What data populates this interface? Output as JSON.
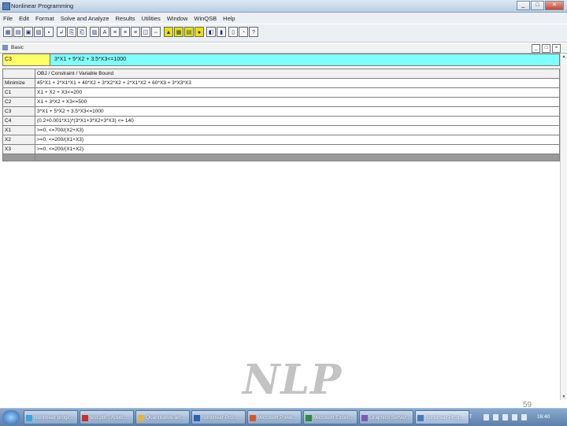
{
  "window": {
    "title": "Nonlinear Programming",
    "min": "_",
    "max": "□",
    "close": "✕"
  },
  "menu": [
    "File",
    "Edit",
    "Format",
    "Solve and Analyze",
    "Results",
    "Utilities",
    "Window",
    "WinQSB",
    "Help"
  ],
  "toolbar": {
    "buttons": [
      {
        "glyph": "▦",
        "icon": "new-icon",
        "hl": false
      },
      {
        "glyph": "▤",
        "icon": "open-icon",
        "hl": false
      },
      {
        "glyph": "▣",
        "icon": "save-icon",
        "hl": false
      },
      {
        "glyph": "▧",
        "icon": "print-icon",
        "hl": false
      },
      {
        "glyph": "▪",
        "icon": "print-setup-icon",
        "hl": false
      },
      {
        "glyph": "↲",
        "icon": "cut-icon",
        "hl": false
      },
      {
        "glyph": "⎘",
        "icon": "copy-icon",
        "hl": false
      },
      {
        "glyph": "⎗",
        "icon": "paste-icon",
        "hl": false
      },
      {
        "glyph": "▥",
        "icon": "format-number-icon",
        "hl": false
      },
      {
        "glyph": "A",
        "icon": "font-icon",
        "hl": false
      },
      {
        "glyph": "≡",
        "icon": "align-left-icon",
        "hl": false
      },
      {
        "glyph": "≡",
        "icon": "align-center-icon",
        "hl": false
      },
      {
        "glyph": "≡",
        "icon": "align-right-icon",
        "hl": false
      },
      {
        "glyph": "◫",
        "icon": "row-height-icon",
        "hl": false
      },
      {
        "glyph": "⇔",
        "icon": "column-width-icon",
        "hl": false
      },
      {
        "glyph": "▲",
        "icon": "solve-icon",
        "hl": true
      },
      {
        "glyph": "▦",
        "icon": "grid-solve-icon",
        "hl": true
      },
      {
        "glyph": "▤",
        "icon": "analysis-icon",
        "hl": true
      },
      {
        "glyph": "●",
        "icon": "graph-icon",
        "hl": true
      },
      {
        "glyph": "◧",
        "icon": "chart-icon",
        "hl": false
      },
      {
        "glyph": "▮",
        "icon": "bar-chart-icon",
        "hl": false
      },
      {
        "glyph": "▯",
        "icon": "window-icon",
        "hl": false
      },
      {
        "glyph": "◔",
        "icon": "clock-icon",
        "hl": false
      },
      {
        "glyph": "?",
        "icon": "help-icon",
        "hl": false
      }
    ]
  },
  "document": {
    "title": "Basic",
    "min": "_",
    "max": "□",
    "close": "×"
  },
  "edit_bar": {
    "cell_ref": "C3",
    "cell_value": "3*X1 + 5*X2 + 3.5*X3<=1000"
  },
  "table": {
    "header": [
      "",
      "OBJ / Constraint / Variable Bound"
    ],
    "rows": [
      {
        "label": "Minimize",
        "value": "45*X1 + 2*X1*X1 + 40*X2 + 3*X2*X2 + 2*X1*X2 + 60*X3 + 3*X3*X3"
      },
      {
        "label": "C1",
        "value": "X1 + X2 + X3<=200"
      },
      {
        "label": "C2",
        "value": "X1 + 3*X2 + X3<=500"
      },
      {
        "label": "C3",
        "value": "3*X1 + 5*X2 + 3.5*X3<=1000"
      },
      {
        "label": "C4",
        "value": "(0.2+0.001*X1)*(3*X1+3*X2+3*X3) <= 140"
      },
      {
        "label": "X1",
        "value": ">=0, <=700/(X2+X3)"
      },
      {
        "label": "X2",
        "value": ">=0, <=200/(X1+X3)"
      },
      {
        "label": "X3",
        "value": ">=0, <=200/(X1+X2)"
      }
    ]
  },
  "watermark": "NLP",
  "page_number": "59",
  "taskbar": {
    "tasks": [
      {
        "label": "Nonlinear progr...",
        "icon": "ie-icon",
        "color": "#3aa3e0"
      },
      {
        "label": "test.pdf - Adob...",
        "icon": "pdf-icon",
        "color": "#c8302a"
      },
      {
        "label": "Quantitative an...",
        "icon": "folder-icon",
        "color": "#e8b23c"
      },
      {
        "label": "Nonlinear Pro...",
        "icon": "word-icon",
        "color": "#2b5fb8"
      },
      {
        "label": "Microsoft Powe...",
        "icon": "powerpoint-icon",
        "color": "#d7562a"
      },
      {
        "label": "Microsoft Excel...",
        "icon": "excel-icon",
        "color": "#2e8b3e"
      },
      {
        "label": "Graphics Server...",
        "icon": "graphics-icon",
        "color": "#7e5bb3"
      },
      {
        "label": "Nonlinear Prog...",
        "icon": "winqsb-icon",
        "color": "#4a7ab8"
      }
    ],
    "lang": "IT",
    "clock": "16:40"
  }
}
